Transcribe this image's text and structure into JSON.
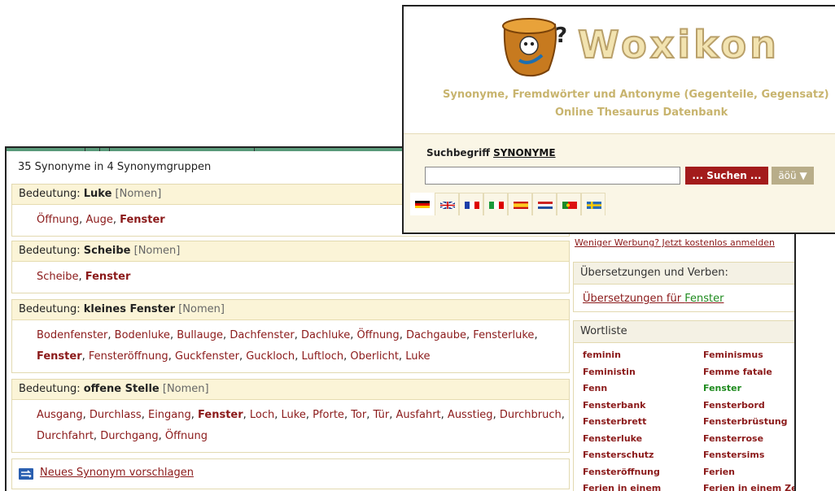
{
  "results": {
    "summary": "35 Synonyme in 4 Synonymgruppen",
    "groups": [
      {
        "prefix": "Bedeutung: ",
        "word": "Luke",
        "pos": "[Nomen]",
        "synonyms": [
          {
            "text": "Öffnung",
            "bold": false
          },
          {
            "text": "Auge",
            "bold": false
          },
          {
            "text": "Fenster",
            "bold": true
          }
        ]
      },
      {
        "prefix": "Bedeutung: ",
        "word": "Scheibe",
        "pos": "[Nomen]",
        "synonyms": [
          {
            "text": "Scheibe",
            "bold": false
          },
          {
            "text": "Fenster",
            "bold": true
          }
        ]
      },
      {
        "prefix": "Bedeutung: ",
        "word": "kleines Fenster",
        "pos": "[Nomen]",
        "synonyms": [
          {
            "text": "Bodenfenster",
            "bold": false
          },
          {
            "text": "Bodenluke",
            "bold": false
          },
          {
            "text": "Bullauge",
            "bold": false
          },
          {
            "text": "Dachfenster",
            "bold": false
          },
          {
            "text": "Dachluke",
            "bold": false
          },
          {
            "text": "Öffnung",
            "bold": false
          },
          {
            "text": "Dachgaube",
            "bold": false
          },
          {
            "text": "Fensterluke",
            "bold": false
          },
          {
            "text": "Fenster",
            "bold": true
          },
          {
            "text": "Fensteröffnung",
            "bold": false
          },
          {
            "text": "Guckfenster",
            "bold": false
          },
          {
            "text": "Guckloch",
            "bold": false
          },
          {
            "text": "Luftloch",
            "bold": false
          },
          {
            "text": "Oberlicht",
            "bold": false
          },
          {
            "text": "Luke",
            "bold": false
          }
        ]
      },
      {
        "prefix": "Bedeutung: ",
        "word": "offene Stelle",
        "pos": "[Nomen]",
        "synonyms": [
          {
            "text": "Ausgang",
            "bold": false
          },
          {
            "text": "Durchlass",
            "bold": false
          },
          {
            "text": "Eingang",
            "bold": false
          },
          {
            "text": "Fenster",
            "bold": true
          },
          {
            "text": "Loch",
            "bold": false
          },
          {
            "text": "Luke",
            "bold": false
          },
          {
            "text": "Pforte",
            "bold": false
          },
          {
            "text": "Tor",
            "bold": false
          },
          {
            "text": "Tür",
            "bold": false
          },
          {
            "text": "Ausfahrt",
            "bold": false
          },
          {
            "text": "Ausstieg",
            "bold": false
          },
          {
            "text": "Durchbruch",
            "bold": false
          },
          {
            "text": "Durchfahrt",
            "bold": false
          },
          {
            "text": "Durchgang",
            "bold": false
          },
          {
            "text": "Öffnung",
            "bold": false
          }
        ]
      }
    ],
    "suggest": {
      "icon": "swap-arrows-icon",
      "label": "Neues Synonym vorschlagen"
    }
  },
  "sidebar": {
    "ad_link": "Weniger Werbung? Jetzt kostenlos anmelden",
    "translations_heading": "Übersetzungen und Verben:",
    "translations_link_prefix": "Übersetzungen für ",
    "translations_link_word": "Fenster",
    "wordlist_heading": "Wortliste",
    "wordlist": [
      {
        "text": "feminin",
        "highlight": false
      },
      {
        "text": "Feminismus",
        "highlight": false
      },
      {
        "text": "Feministin",
        "highlight": false
      },
      {
        "text": "Femme fatale",
        "highlight": false
      },
      {
        "text": "Fenn",
        "highlight": false
      },
      {
        "text": "Fenster",
        "highlight": true
      },
      {
        "text": "Fensterbank",
        "highlight": false
      },
      {
        "text": "Fensterbord",
        "highlight": false
      },
      {
        "text": "Fensterbrett",
        "highlight": false
      },
      {
        "text": "Fensterbrüstung",
        "highlight": false
      },
      {
        "text": "Fensterluke",
        "highlight": false
      },
      {
        "text": "Fensterrose",
        "highlight": false
      },
      {
        "text": "Fensterschutz",
        "highlight": false
      },
      {
        "text": "Fenstersims",
        "highlight": false
      },
      {
        "text": "Fensteröffnung",
        "highlight": false
      },
      {
        "text": "Ferien",
        "highlight": false
      },
      {
        "text": "Ferien in einem",
        "highlight": false
      },
      {
        "text": "Ferien in einem Zelt",
        "highlight": false
      }
    ]
  },
  "search": {
    "brand": "Woxikon",
    "logo_icon": "woxikon-bucket-logo-icon",
    "tagline_line1": "Synonyme, Fremdwörter und Antonyme (Gegenteile, Gegensatz)",
    "tagline_line2": "Online Thesaurus Datenbank",
    "label": "Suchbegriff ",
    "label_keyword": "SYNONYME",
    "input_value": "",
    "button_label": "... Suchen ...",
    "umlaut_button_label": "äöü ▼",
    "languages": [
      "german-flag-icon",
      "uk-flag-icon",
      "french-flag-icon",
      "italian-flag-icon",
      "spanish-flag-icon",
      "dutch-flag-icon",
      "portuguese-flag-icon",
      "swedish-flag-icon"
    ]
  },
  "colors": {
    "link": "#8b1a1a",
    "highlight": "#1f8b1f",
    "group_header_bg": "#fbf4d7",
    "search_button": "#a31b1b"
  }
}
